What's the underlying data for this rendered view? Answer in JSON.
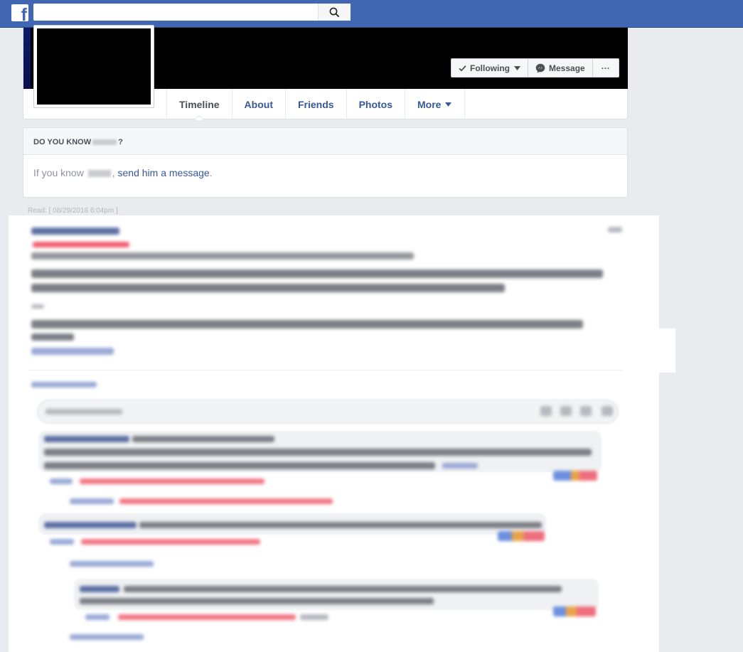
{
  "topbar": {
    "logo": "f",
    "search_placeholder": "",
    "search_icon": "search-icon"
  },
  "profile": {
    "actions": {
      "following_label": "Following",
      "message_label": "Message",
      "more_label": "···"
    },
    "tabs": [
      {
        "label": "Timeline",
        "active": true
      },
      {
        "label": "About"
      },
      {
        "label": "Friends"
      },
      {
        "label": "Photos"
      },
      {
        "label": "More"
      }
    ]
  },
  "know_card": {
    "heading_prefix": "DO YOU KNOW",
    "heading_suffix": "?",
    "body_prefix": "If you know",
    "body_link": "send him a message",
    "body_suffix": "."
  },
  "read_receipt": "Read: [ 08/29/2018 6:04pm ]",
  "colors": {
    "brand_blue": "#4267b2",
    "link_blue": "#365899",
    "page_bg": "#e9ebee"
  }
}
